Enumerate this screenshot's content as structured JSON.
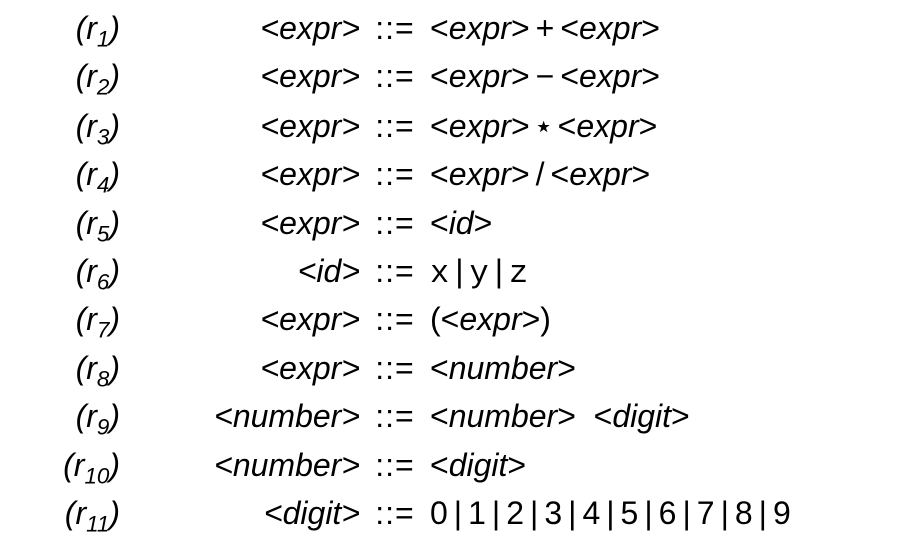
{
  "rules": [
    {
      "num": "1",
      "lhs": "expr",
      "rhs": [
        {
          "t": "nt",
          "v": "expr"
        },
        {
          "t": "op",
          "v": "+"
        },
        {
          "t": "nt",
          "v": "expr"
        }
      ]
    },
    {
      "num": "2",
      "lhs": "expr",
      "rhs": [
        {
          "t": "nt",
          "v": "expr"
        },
        {
          "t": "op",
          "v": "−"
        },
        {
          "t": "nt",
          "v": "expr"
        }
      ]
    },
    {
      "num": "3",
      "lhs": "expr",
      "rhs": [
        {
          "t": "nt",
          "v": "expr"
        },
        {
          "t": "star",
          "v": "⋆"
        },
        {
          "t": "nt",
          "v": "expr"
        }
      ]
    },
    {
      "num": "4",
      "lhs": "expr",
      "rhs": [
        {
          "t": "nt",
          "v": "expr"
        },
        {
          "t": "op",
          "v": "/"
        },
        {
          "t": "nt",
          "v": "expr"
        }
      ]
    },
    {
      "num": "5",
      "lhs": "expr",
      "rhs": [
        {
          "t": "nt",
          "v": "id"
        }
      ]
    },
    {
      "num": "6",
      "lhs": "id",
      "rhs": [
        {
          "t": "tt",
          "v": "x"
        },
        {
          "t": "bar",
          "v": "|"
        },
        {
          "t": "tt",
          "v": "y"
        },
        {
          "t": "bar",
          "v": "|"
        },
        {
          "t": "tt",
          "v": "z"
        }
      ]
    },
    {
      "num": "7",
      "lhs": "expr",
      "rhs": [
        {
          "t": "txt",
          "v": "("
        },
        {
          "t": "nt",
          "v": "expr"
        },
        {
          "t": "txt",
          "v": ")"
        }
      ]
    },
    {
      "num": "8",
      "lhs": "expr",
      "rhs": [
        {
          "t": "nt",
          "v": "number"
        }
      ]
    },
    {
      "num": "9",
      "lhs": "number",
      "rhs": [
        {
          "t": "nt",
          "v": "number"
        },
        {
          "t": "sp",
          "v": " "
        },
        {
          "t": "nt",
          "v": "digit"
        }
      ]
    },
    {
      "num": "10",
      "lhs": "number",
      "rhs": [
        {
          "t": "nt",
          "v": "digit"
        }
      ]
    },
    {
      "num": "11",
      "lhs": "digit",
      "rhs": [
        {
          "t": "txt",
          "v": "0"
        },
        {
          "t": "bar",
          "v": "|"
        },
        {
          "t": "txt",
          "v": "1"
        },
        {
          "t": "bar",
          "v": "|"
        },
        {
          "t": "txt",
          "v": "2"
        },
        {
          "t": "bar",
          "v": "|"
        },
        {
          "t": "txt",
          "v": "3"
        },
        {
          "t": "bar",
          "v": "|"
        },
        {
          "t": "txt",
          "v": "4"
        },
        {
          "t": "bar",
          "v": "|"
        },
        {
          "t": "txt",
          "v": "5"
        },
        {
          "t": "bar",
          "v": "|"
        },
        {
          "t": "txt",
          "v": "6"
        },
        {
          "t": "bar",
          "v": "|"
        },
        {
          "t": "txt",
          "v": "7"
        },
        {
          "t": "bar",
          "v": "|"
        },
        {
          "t": "txt",
          "v": "8"
        },
        {
          "t": "bar",
          "v": "|"
        },
        {
          "t": "txt",
          "v": "9"
        }
      ]
    }
  ],
  "symbols": {
    "derives": "::=",
    "r_letter": "r",
    "lt": "<",
    "gt": ">",
    "lparen": "(",
    "rparen": ")"
  }
}
